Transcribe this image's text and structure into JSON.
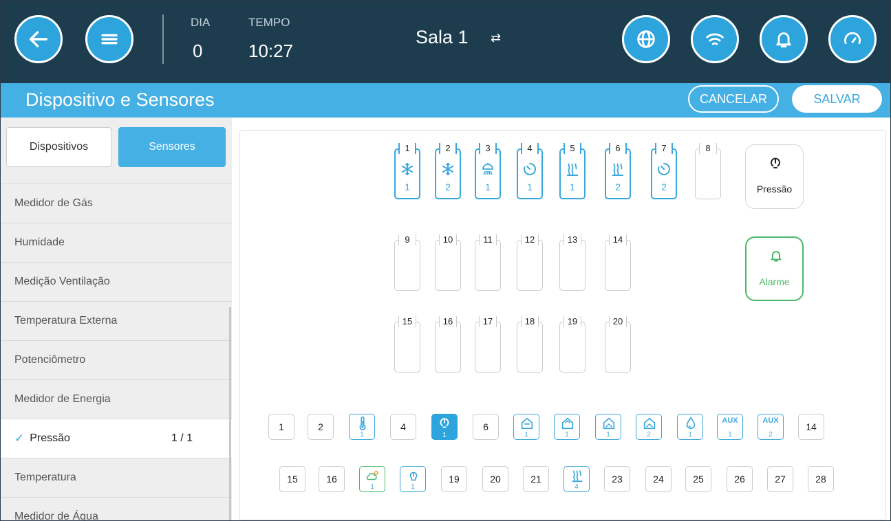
{
  "header": {
    "day_label": "DIA",
    "day_value": "0",
    "time_label": "TEMPO",
    "time_value": "10:27",
    "room": "Sala 1",
    "room_switch_glyph": "⇄"
  },
  "titlebar": {
    "title": "Dispositivo e Sensores",
    "cancel": "CANCELAR",
    "save": "SALVAR"
  },
  "tabs": {
    "devices": "Dispositivos",
    "sensors": "Sensores"
  },
  "sensor_list": [
    {
      "label": "Medidor de Gás"
    },
    {
      "label": "Humidade"
    },
    {
      "label": "Medição Ventilação"
    },
    {
      "label": "Temperatura Externa"
    },
    {
      "label": "Potenciômetro"
    },
    {
      "label": "Medidor de Energia"
    },
    {
      "label": "Pressão",
      "count": "1 / 1",
      "selected": true
    },
    {
      "label": "Temperatura"
    },
    {
      "label": "Medidor de Água"
    }
  ],
  "slots": [
    {
      "n": "1",
      "icon": "snowflake-icon",
      "sub": "1"
    },
    {
      "n": "2",
      "icon": "snowflake-icon",
      "sub": "2"
    },
    {
      "n": "3",
      "icon": "shower-icon",
      "sub": "1"
    },
    {
      "n": "4",
      "icon": "timer-icon",
      "sub": "1"
    },
    {
      "n": "5",
      "icon": "heater-icon",
      "sub": "1"
    },
    {
      "n": "6",
      "icon": "heater-icon",
      "sub": "2"
    },
    {
      "n": "7",
      "icon": "timer-icon",
      "sub": "2"
    },
    {
      "n": "8"
    },
    {
      "n": "9"
    },
    {
      "n": "10"
    },
    {
      "n": "11"
    },
    {
      "n": "12"
    },
    {
      "n": "13"
    },
    {
      "n": "14"
    },
    {
      "n": "15"
    },
    {
      "n": "16"
    },
    {
      "n": "17"
    },
    {
      "n": "18"
    },
    {
      "n": "19"
    },
    {
      "n": "20"
    }
  ],
  "pressure_box": {
    "label": "Pressão",
    "icon": "pressure-gauge-icon"
  },
  "alarm_box": {
    "label": "Alarme",
    "icon": "bell-icon"
  },
  "inputs_row1": [
    {
      "text": "1"
    },
    {
      "text": "2"
    },
    {
      "icon": "thermometer-icon",
      "sub": "1"
    },
    {
      "text": "4"
    },
    {
      "icon": "pressure-gauge-icon",
      "sub": "1",
      "active": true
    },
    {
      "text": "6"
    },
    {
      "icon": "curtain-icon",
      "sub": "1"
    },
    {
      "icon": "inlet-icon",
      "sub": "1"
    },
    {
      "icon": "tunnel-door-icon",
      "sub": "1"
    },
    {
      "icon": "tunnel-door-icon",
      "sub": "2"
    },
    {
      "icon": "water-drop-icon",
      "sub": "1"
    },
    {
      "aux": "AUX",
      "sub": "1"
    },
    {
      "aux": "AUX",
      "sub": "2"
    },
    {
      "text": "14"
    }
  ],
  "inputs_row2": [
    {
      "text": "15"
    },
    {
      "text": "16"
    },
    {
      "icon": "outdoor-weather-icon",
      "sub": "1"
    },
    {
      "icon": "potentiometer-icon",
      "sub": "1"
    },
    {
      "text": "19"
    },
    {
      "text": "20"
    },
    {
      "text": "21"
    },
    {
      "icon": "heater-icon",
      "sub": "4"
    },
    {
      "text": "23"
    },
    {
      "text": "24"
    },
    {
      "text": "25"
    },
    {
      "text": "26"
    },
    {
      "text": "27"
    },
    {
      "text": "28"
    }
  ],
  "colors": {
    "header_bg": "#1d3d4f",
    "accent": "#45b0e3",
    "button": "#2ea4dc",
    "alarm_green": "#4bb86a"
  }
}
